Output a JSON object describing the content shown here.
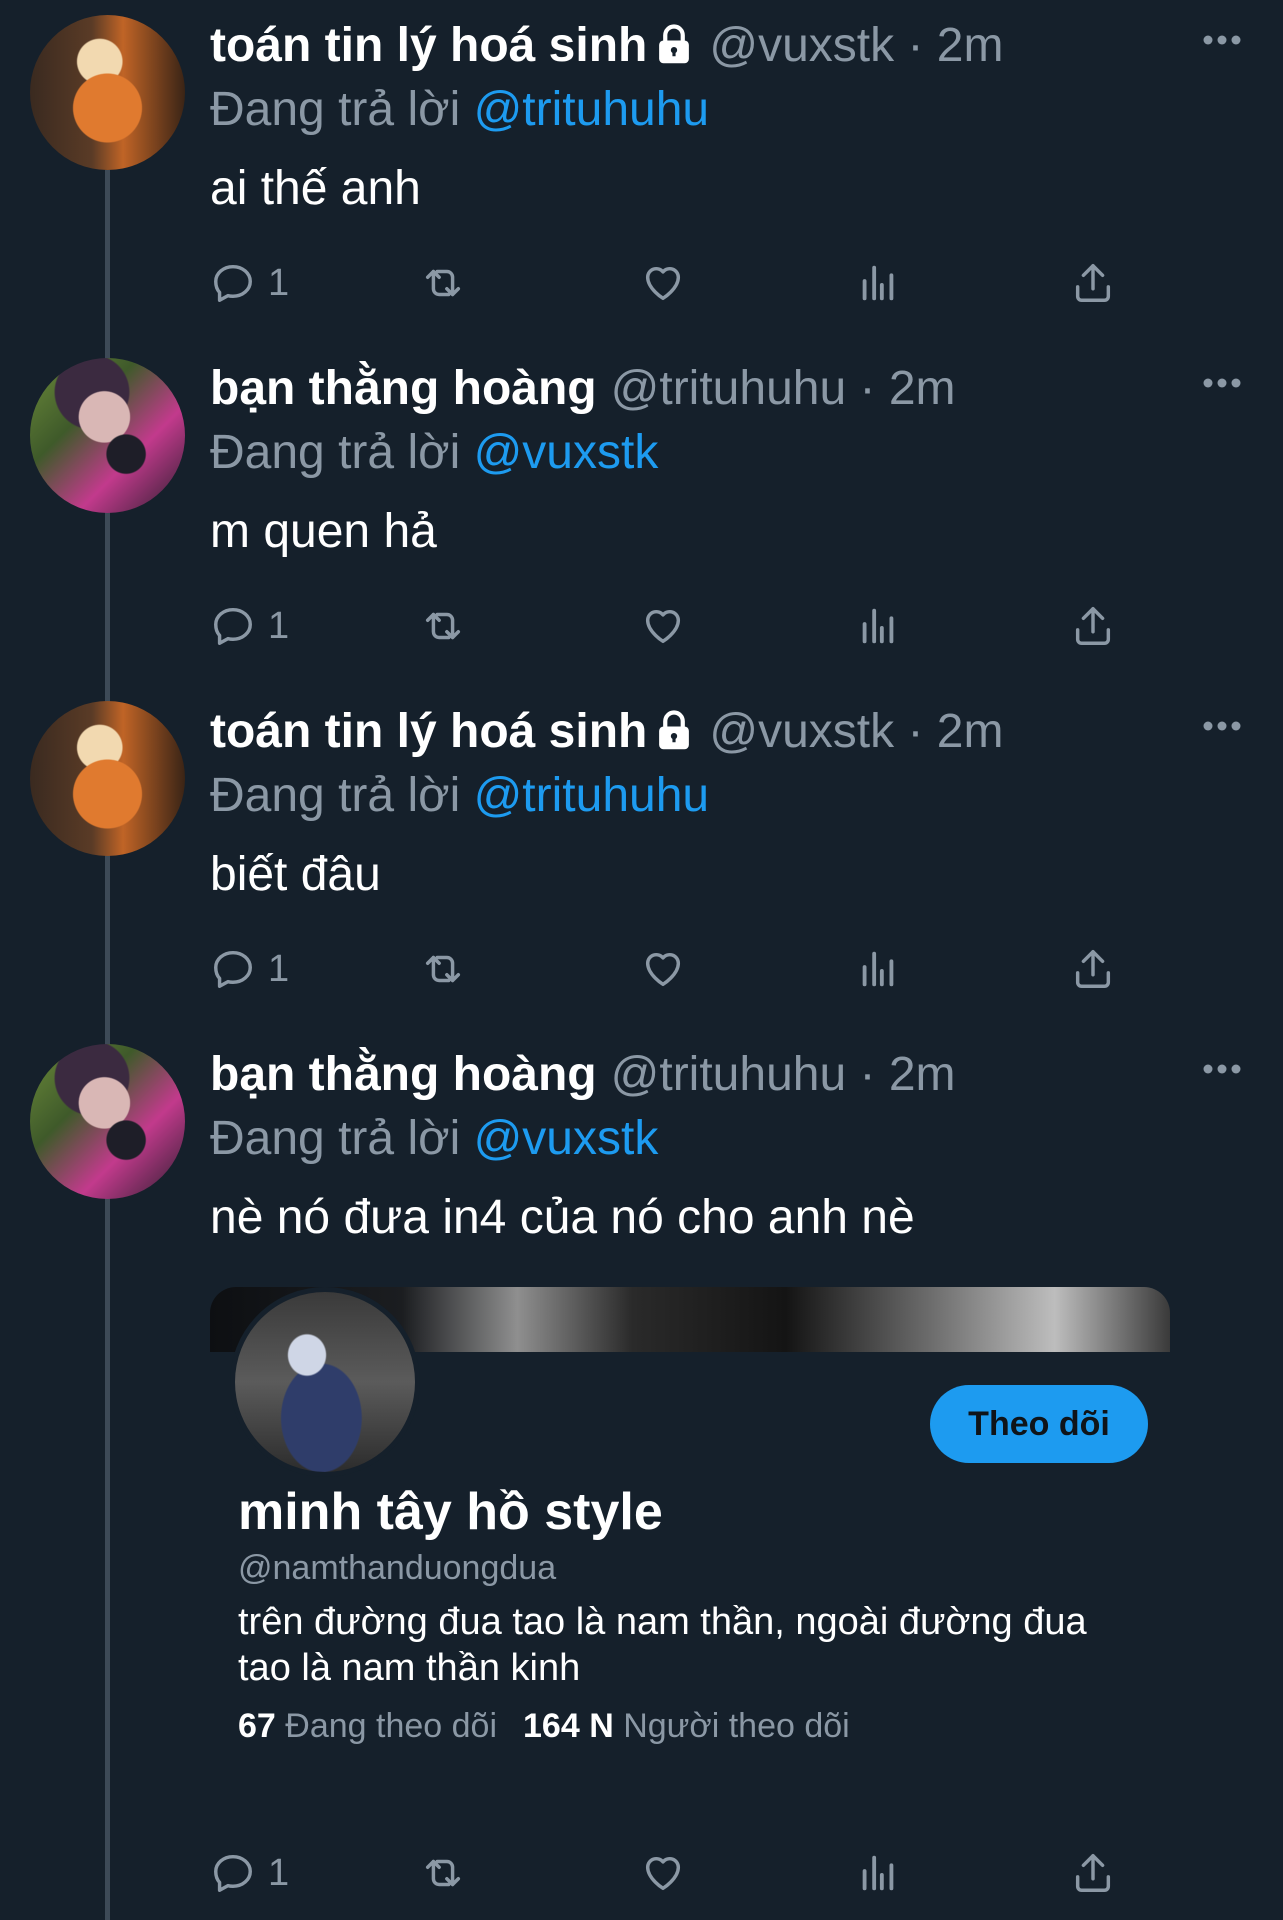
{
  "colors": {
    "background": "#15202b",
    "muted": "#8b98a5",
    "accent": "#1d9bf0",
    "text": "#ffffff"
  },
  "icons": {
    "reply": "reply-icon",
    "retweet": "retweet-icon",
    "like": "heart-icon",
    "views": "views-icon",
    "share": "share-icon",
    "more": "more-icon",
    "lock": "lock-icon"
  },
  "tweets": [
    {
      "name": "toán tin lý hoá sinh",
      "locked": true,
      "handle": "@vuxstk",
      "time": "· 2m",
      "reply_prefix": "Đang trả lời ",
      "reply_to": "@trituhuhu",
      "text": "ai thế anh",
      "reply_count": "1"
    },
    {
      "name": "bạn thằng hoàng",
      "locked": false,
      "handle": "@trituhuhu",
      "time": "· 2m",
      "reply_prefix": "Đang trả lời ",
      "reply_to": "@vuxstk",
      "text": "m quen hả",
      "reply_count": "1"
    },
    {
      "name": "toán tin lý hoá sinh",
      "locked": true,
      "handle": "@vuxstk",
      "time": "· 2m",
      "reply_prefix": "Đang trả lời ",
      "reply_to": "@trituhuhu",
      "text": "biết đâu",
      "reply_count": "1"
    },
    {
      "name": "bạn thằng hoàng",
      "locked": false,
      "handle": "@trituhuhu",
      "time": "· 2m",
      "reply_prefix": "Đang trả lời ",
      "reply_to": "@vuxstk",
      "text": "nè nó đưa in4 của nó cho anh nè",
      "reply_count": "1"
    }
  ],
  "profile_card": {
    "follow_label": "Theo dõi",
    "name": "minh tây hồ style",
    "handle": "@namthanduongdua",
    "bio": "trên đường đua tao là nam thần, ngoài đường đua tao là nam thần kinh",
    "following_count": "67",
    "following_label": "Đang theo dõi",
    "followers_count": "164 N",
    "followers_label": "Người theo dõi"
  }
}
